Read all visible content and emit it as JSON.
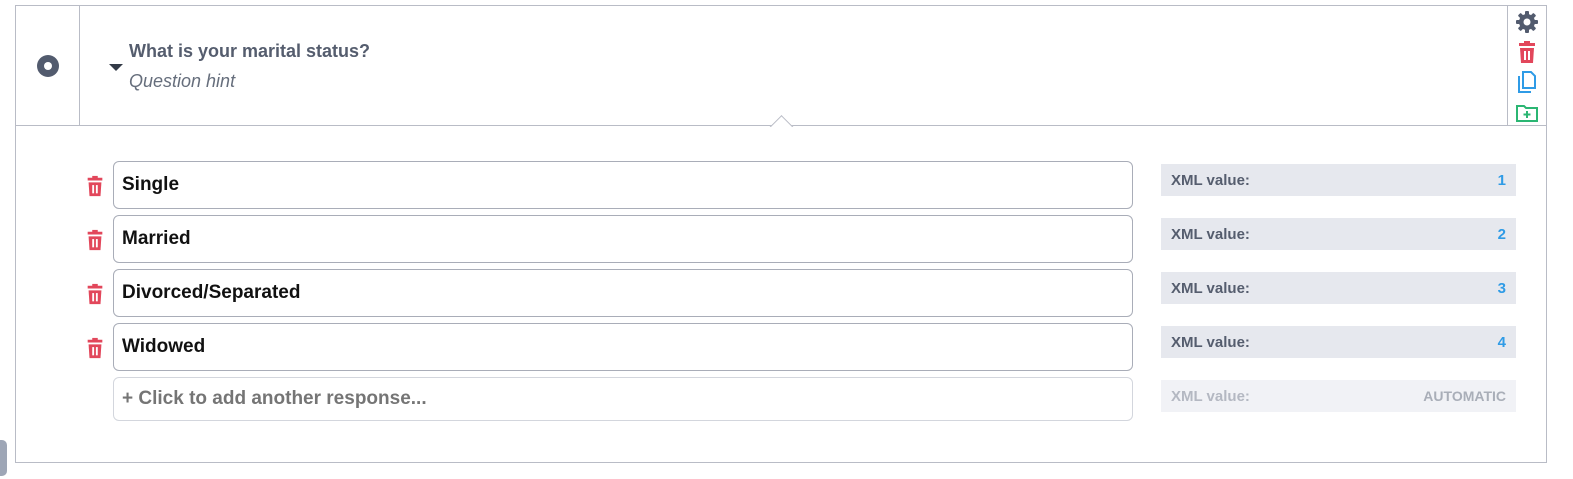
{
  "question": {
    "title": "What is your marital status?",
    "hint": "Question hint",
    "type_icon": "radio-icon"
  },
  "actions": {
    "icons": [
      "gear-icon",
      "trash-icon",
      "copy-icon",
      "folder-plus-icon"
    ]
  },
  "responses": [
    {
      "label": "Single",
      "xml_label": "XML value:",
      "xml_value": "1"
    },
    {
      "label": "Married",
      "xml_label": "XML value:",
      "xml_value": "2"
    },
    {
      "label": "Divorced/Separated",
      "xml_label": "XML value:",
      "xml_value": "3"
    },
    {
      "label": "Widowed",
      "xml_label": "XML value:",
      "xml_value": "4"
    }
  ],
  "add_response": {
    "placeholder": "+ Click to add another response...",
    "xml_label": "XML value:",
    "xml_value": "AUTOMATIC"
  },
  "colors": {
    "danger": "#e2475b",
    "accent": "#2f9be6",
    "success": "#2bb673",
    "icon_dark": "#525b6e"
  }
}
